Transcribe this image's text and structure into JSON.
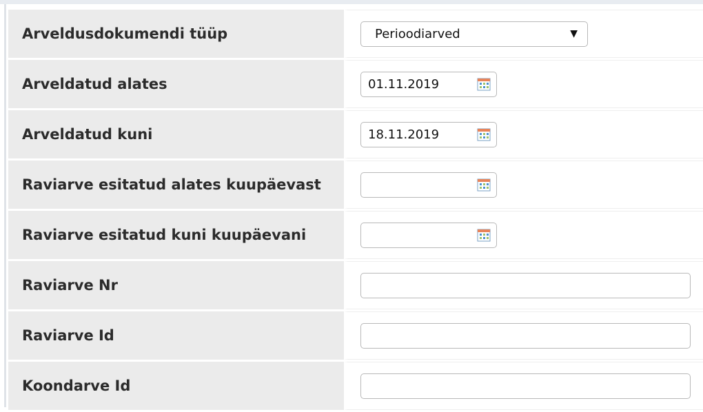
{
  "form": {
    "document_type": {
      "label": "Arveldusdokumendi tüüp",
      "value": "Perioodiarved",
      "arrow": "▼"
    },
    "billed_from": {
      "label": "Arveldatud alates",
      "value": "01.11.2019",
      "icon": "calendar-icon"
    },
    "billed_to": {
      "label": "Arveldatud kuni",
      "value": "18.11.2019",
      "icon": "calendar-icon"
    },
    "submitted_from": {
      "label": "Raviarve esitatud alates kuupäevast",
      "value": "",
      "icon": "calendar-icon"
    },
    "submitted_to": {
      "label": "Raviarve esitatud kuni kuupäevani",
      "value": "",
      "icon": "calendar-icon"
    },
    "invoice_nr": {
      "label": "Raviarve Nr",
      "value": ""
    },
    "invoice_id": {
      "label": "Raviarve Id",
      "value": ""
    },
    "summary_invoice_id": {
      "label": "Koondarve Id",
      "value": ""
    }
  },
  "colors": {
    "label_background": "#ebebeb",
    "input_border": "#b8b8b8",
    "calendar_accent": "#4a8fd0",
    "calendar_header": "#e8845a"
  }
}
